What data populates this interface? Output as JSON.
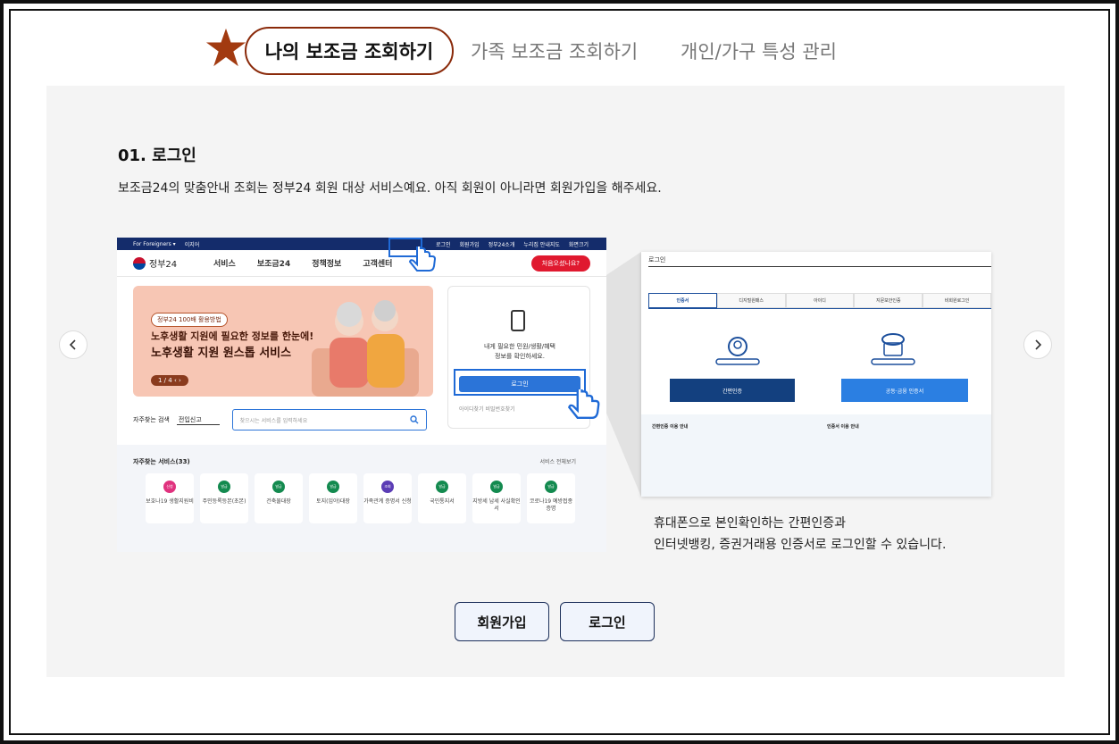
{
  "tabs": [
    {
      "label": "나의 보조금 조회하기"
    },
    {
      "label": "가족 보조금 조회하기"
    },
    {
      "label": "개인/가구 특성 관리"
    }
  ],
  "step": {
    "title": "01. 로그인",
    "description": "보조금24의 맞춤안내 조회는 정부24 회원 대상 서비스예요. 아직 회원이 아니라면 회원가입을 해주세요."
  },
  "screenshot1": {
    "topbar_left": [
      "For Foreigners ▾",
      "이지어"
    ],
    "topbar_right": [
      "로그인",
      "회원가입",
      "정부24소개",
      "누리집 안내지도",
      "화면크기"
    ],
    "logo": "정부24",
    "menu": [
      "서비스",
      "보조금24",
      "정책정보",
      "고객센터"
    ],
    "red_button": "처음오셨나요?",
    "banner_pill": "정부24 100배 활용방법",
    "banner_line1": "노후생활 지원에 필요한 정보를 한눈에!",
    "banner_line2": "노후생활 지원 원스톱 서비스",
    "banner_page": "1 / 4  ‹  ›",
    "login_text_1": "내게 필요한 민원/생활/혜택",
    "login_text_2": "정보를 확인하세요.",
    "login_button": "로그인",
    "login_sub": "아이디찾기    비밀번호찾기",
    "search_label": "자주찾는 검색",
    "search_select": "전입신고",
    "search_placeholder": "찾으시는 서비스를 입력하세요",
    "freq_title": "자주찾는 서비스(33)",
    "freq_all": "서비스 전체보기",
    "cards": [
      {
        "badge": "신청",
        "label": "보호나19 생활지원비"
      },
      {
        "badge": "발급",
        "label": "주민등록등본(초본)"
      },
      {
        "badge": "발급",
        "label": "건축물대장"
      },
      {
        "badge": "발급",
        "label": "토지(임야)대장"
      },
      {
        "badge": "조회",
        "label": "가족관계 증명서 신청"
      },
      {
        "badge": "발급",
        "label": "국민통지서"
      },
      {
        "badge": "발급",
        "label": "지방세 납세 사실확인서"
      },
      {
        "badge": "발급",
        "label": "코로나19 예방접종 증명"
      }
    ]
  },
  "screenshot2": {
    "title": "로그인",
    "tabs": [
      "인증서",
      "디지털원패스",
      "아이디",
      "지문보안인증",
      "비회원로그인"
    ],
    "btn_simple": "간편인증",
    "btn_cert": "공동·금융 인증서",
    "info_left_title": "간편인증 이용 안내",
    "info_right_title": "인증서 이용 안내"
  },
  "caption": {
    "line1": "휴대폰으로 본인확인하는 간편인증과",
    "line2": "인터넷뱅킹, 증권거래용 인증서로 로그인할 수 있습니다."
  },
  "buttons": {
    "signup": "회원가입",
    "login": "로그인"
  },
  "colors": {
    "accent_star": "#a23a10",
    "active_border": "#8a2a0a",
    "panel_bg": "#f4f4f4",
    "gov_navy": "#142c6b",
    "gov_blue": "#2b74d8"
  }
}
